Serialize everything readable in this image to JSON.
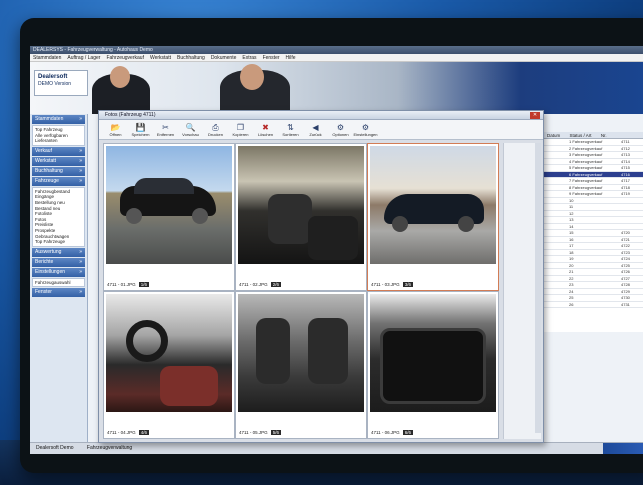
{
  "app": {
    "title": "DEALERSYS - Fahrzeugverwaltung - Autohaus Demo",
    "menu": [
      "Stammdaten",
      "Auftrag / Lager",
      "Fahrzeugverkauf",
      "Werkstatt",
      "Buchhaltung",
      "Dokumente",
      "Extras",
      "Fenster",
      "Hilfe"
    ],
    "brand_line1": "Dealersoft",
    "brand_line2": "DEMO Version"
  },
  "sidebar": {
    "sections": [
      {
        "label": "Stammdaten",
        "items": [
          "Top Fahrzeug",
          "Alle verfügbaren",
          "Lieferanten"
        ]
      },
      {
        "label": "Verkauf",
        "items": []
      },
      {
        "label": "Werkstatt",
        "items": []
      },
      {
        "label": "Buchhaltung",
        "items": []
      },
      {
        "label": "Fahrzeuge",
        "items": [
          "Fahrzeugbestand",
          "Eingänge",
          "Bestellung neu",
          "Bestand neu",
          "Fotoliste",
          "Fotos",
          "Preisliste",
          "Prospekte",
          "Gebrauchtwagen",
          "Top Fahrzeuge"
        ]
      },
      {
        "label": "Auswertung",
        "items": []
      },
      {
        "label": "Berichte",
        "items": []
      },
      {
        "label": "Einstellungen",
        "items": []
      }
    ],
    "footer_item": "Fahrzeugauswahl",
    "last_section": "Fenster"
  },
  "viewer": {
    "title": "Fotos (Fahrzeug 4711)",
    "toolbar": [
      {
        "icon": "open-icon",
        "label": "Öffnen"
      },
      {
        "icon": "save-icon",
        "label": "Speichern"
      },
      {
        "icon": "cut-icon",
        "label": "Entfernen"
      },
      {
        "icon": "zoom-icon",
        "label": "Vorschau"
      },
      {
        "icon": "print-icon",
        "label": "Drucken"
      },
      {
        "icon": "copy-icon",
        "label": "Kopieren"
      },
      {
        "icon": "delete-icon",
        "label": "Löschen"
      },
      {
        "icon": "sort-icon",
        "label": "Sortieren"
      },
      {
        "icon": "left-icon",
        "label": "Zurück"
      },
      {
        "icon": "settings-icon",
        "label": "Optionen"
      },
      {
        "icon": "settings-icon",
        "label": "Einstellungen"
      }
    ],
    "photos": [
      {
        "name": "photo-front-exterior",
        "label": "4711 - 01.JPG",
        "page": "1/6",
        "kind": "car1"
      },
      {
        "name": "photo-driver-seat",
        "label": "4711 - 02.JPG",
        "page": "2/6",
        "kind": "car2"
      },
      {
        "name": "photo-rear-exterior",
        "label": "4711 - 03.JPG",
        "page": "3/6",
        "kind": "car3"
      },
      {
        "name": "photo-dashboard",
        "label": "4711 - 04.JPG",
        "page": "4/6",
        "kind": "int1"
      },
      {
        "name": "photo-rear-seats",
        "label": "4711 - 05.JPG",
        "page": "5/6",
        "kind": "int2"
      },
      {
        "name": "photo-trunk",
        "label": "4711 - 06.JPG",
        "page": "6/6",
        "kind": "trunk"
      }
    ]
  },
  "grid": {
    "headers": [
      "Datum",
      "Status / Art",
      "Nr."
    ],
    "rows": [
      [
        "",
        "1 Fahrzeugverkauf",
        "4711"
      ],
      [
        "",
        "2 Fahrzeugverkauf",
        "4712"
      ],
      [
        "",
        "3 Fahrzeugverkauf",
        "4713"
      ],
      [
        "",
        "4 Fahrzeugverkauf",
        "4714"
      ],
      [
        "",
        "5 Fahrzeugverkauf",
        "4715"
      ],
      [
        "",
        "6 Fahrzeugverkauf",
        "4716"
      ],
      [
        "",
        "7 Fahrzeugverkauf",
        "4717"
      ],
      [
        "",
        "8 Fahrzeugverkauf",
        "4718"
      ],
      [
        "",
        "9 Fahrzeugverkauf",
        "4719"
      ],
      [
        "",
        "10",
        ""
      ],
      [
        "",
        "11",
        ""
      ],
      [
        "",
        "12",
        ""
      ],
      [
        "",
        "13",
        ""
      ],
      [
        "",
        "14",
        ""
      ],
      [
        "",
        "15",
        "4720"
      ],
      [
        "",
        "16",
        "4721"
      ],
      [
        "",
        "17",
        "4722"
      ],
      [
        "",
        "18",
        "4723"
      ],
      [
        "",
        "19",
        "4724"
      ],
      [
        "",
        "20",
        "4725"
      ],
      [
        "",
        "21",
        "4726"
      ],
      [
        "",
        "22",
        "4727"
      ],
      [
        "",
        "23",
        "4728"
      ],
      [
        "",
        "24",
        "4729"
      ],
      [
        "",
        "25",
        "4730"
      ],
      [
        "",
        "26",
        "4731"
      ]
    ],
    "selected_row": 5
  },
  "taskbar": {
    "item1": "Dealersoft Demo",
    "item2": "Fahrzeugverwaltung"
  },
  "colors": {
    "background": "#1a5aa8",
    "selection": "#2c3f8f",
    "sidebar_header": "#3461a6"
  }
}
